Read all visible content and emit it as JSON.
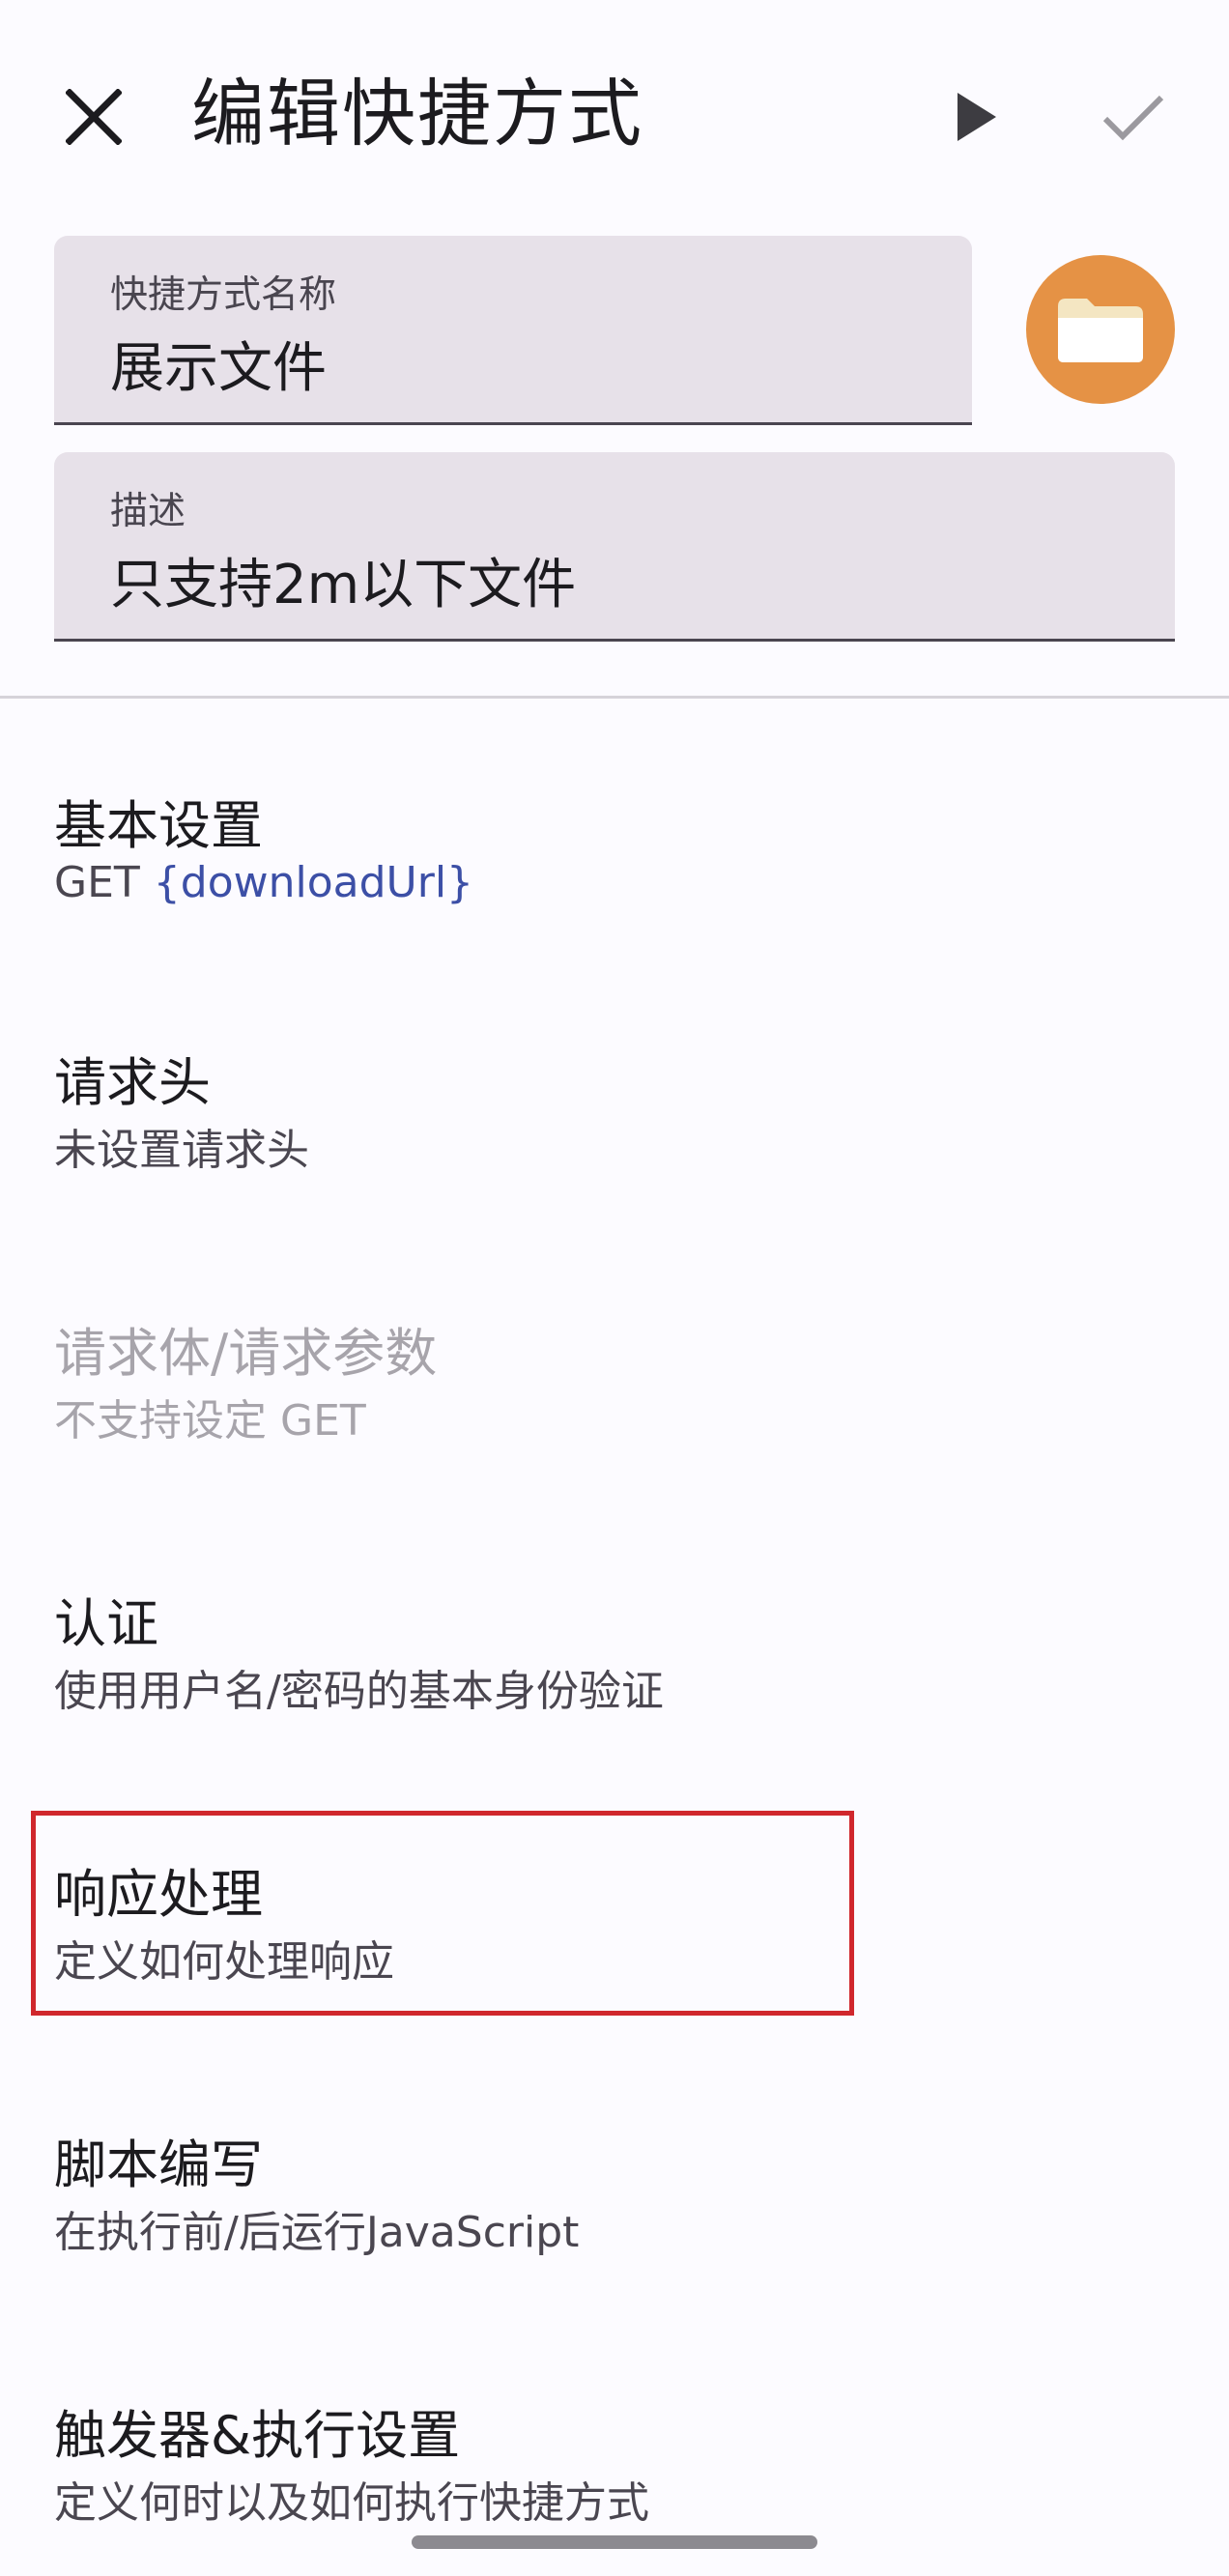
{
  "app": {
    "title": "编辑快捷方式"
  },
  "icons": {
    "close": "close-icon",
    "run": "play-icon",
    "save": "check-icon",
    "shortcut": "folder-icon"
  },
  "colors": {
    "icon_background": "#e59245",
    "field_background": "#e7e1e9",
    "url_token": "#3c4fa6",
    "highlight": "#d0272d"
  },
  "fields": {
    "name": {
      "label": "快捷方式名称",
      "value": "展示文件"
    },
    "description": {
      "label": "描述",
      "value": "只支持2m以下文件"
    }
  },
  "settings": {
    "basic": {
      "title": "基本设置",
      "method": "GET",
      "url": "{downloadUrl}"
    },
    "headers": {
      "title": "请求头",
      "subtitle": "未设置请求头"
    },
    "body": {
      "title": "请求体/请求参数",
      "subtitle": "不支持设定 GET"
    },
    "auth": {
      "title": "认证",
      "subtitle": "使用用户名/密码的基本身份验证"
    },
    "response": {
      "title": "响应处理",
      "subtitle": "定义如何处理响应"
    },
    "scripting": {
      "title": "脚本编写",
      "subtitle": "在执行前/后运行JavaScript"
    },
    "triggers": {
      "title": "触发器&执行设置",
      "subtitle": "定义何时以及如何执行快捷方式"
    }
  }
}
